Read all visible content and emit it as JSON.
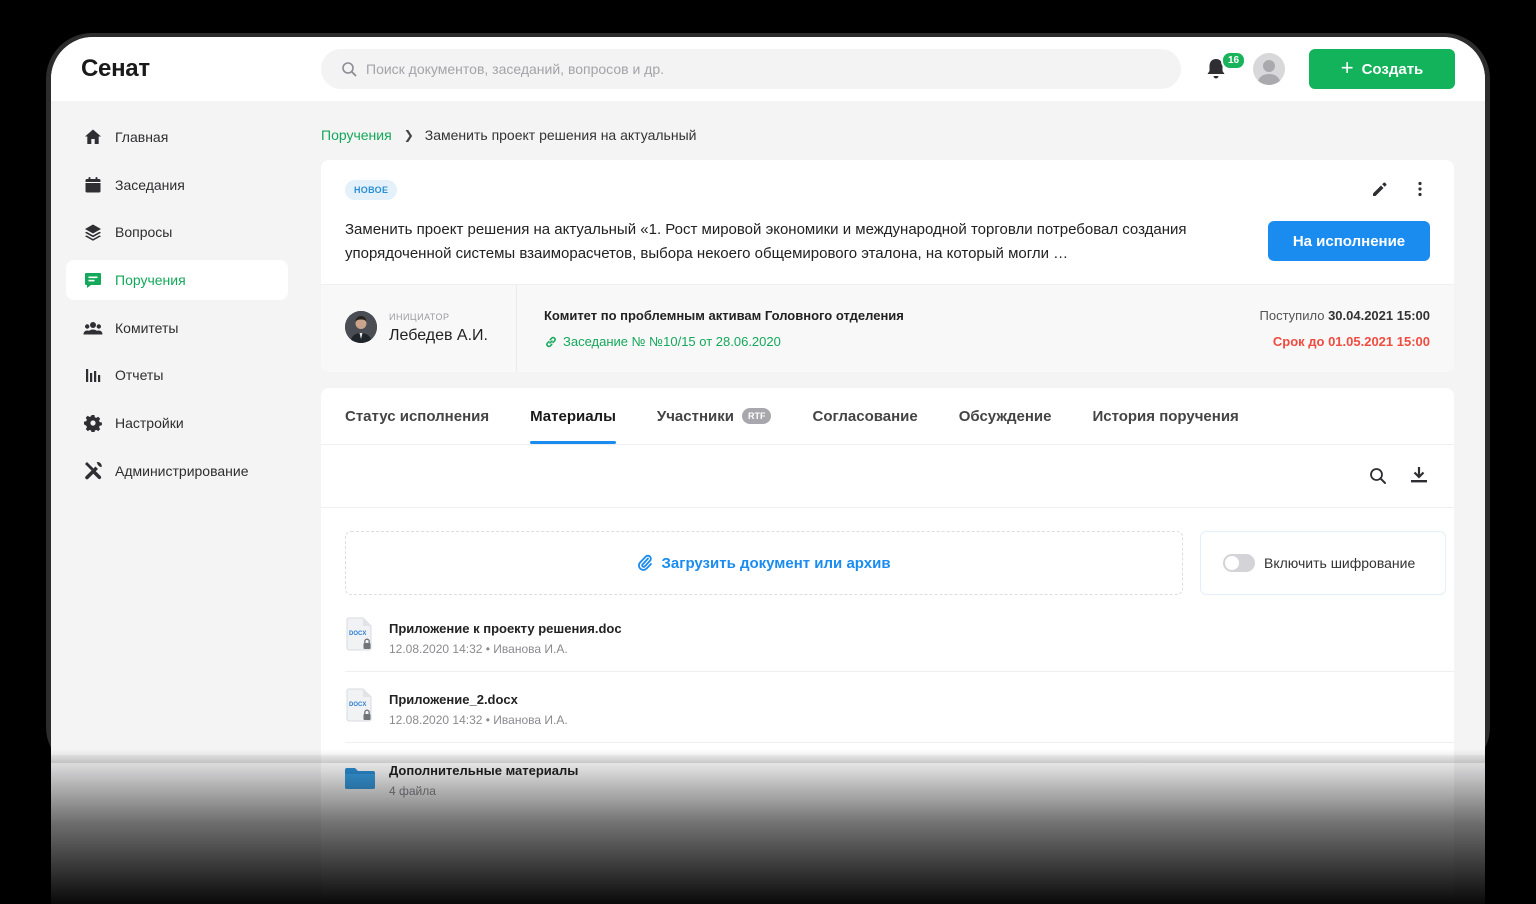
{
  "header": {
    "logo": "Сенат",
    "search_placeholder": "Поиск документов, заседаний, вопросов и др.",
    "notifications_count": "16",
    "create_label": "Создать"
  },
  "sidebar": {
    "items": [
      {
        "label": "Главная",
        "icon": "home-icon"
      },
      {
        "label": "Заседания",
        "icon": "calendar-icon"
      },
      {
        "label": "Вопросы",
        "icon": "layers-icon"
      },
      {
        "label": "Поручения",
        "icon": "message-icon",
        "active": true
      },
      {
        "label": "Комитеты",
        "icon": "people-icon"
      },
      {
        "label": "Отчеты",
        "icon": "bar-chart-icon"
      },
      {
        "label": "Настройки",
        "icon": "gear-icon"
      },
      {
        "label": "Администрирование",
        "icon": "tools-icon"
      }
    ]
  },
  "breadcrumb": {
    "parent": "Поручения",
    "current": "Заменить проект решения на актуальный"
  },
  "task": {
    "status": "НОВОЕ",
    "title": "Заменить проект решения на актуальный «1. Рост мировой экономики и международной торговли потребовал создания упорядоченной системы взаиморасчетов, выбора некоего общемирового эталона, на который могли …",
    "action_label": "На исполнение",
    "initiator_label": "ИНИЦИАТОР",
    "initiator_name": "Лебедев А.И.",
    "committee": "Комитет по проблемным активам Головного отделения",
    "meeting": "Заседание № №10/15 от 28.06.2020",
    "received_label": "Поступило",
    "received_date": "30.04.2021 15:00",
    "deadline": "Срок до 01.05.2021 15:00"
  },
  "tabs": [
    {
      "label": "Статус исполнения"
    },
    {
      "label": "Материалы",
      "active": true
    },
    {
      "label": "Участники",
      "badge": "RTF"
    },
    {
      "label": "Согласование"
    },
    {
      "label": "Обсуждение"
    },
    {
      "label": "История поручения"
    }
  ],
  "materials": {
    "upload_label": "Загрузить документ или архив",
    "encrypt_label": "Включить шифрование",
    "encrypt_enabled": false,
    "files": [
      {
        "name": "Приложение к проекту решения.doc",
        "meta": "12.08.2020 14:32 • Иванова И.А.",
        "type": "docx",
        "icon_label": "DOCX"
      },
      {
        "name": "Приложение_2.docx",
        "meta": "12.08.2020 14:32 • Иванова И.А.",
        "type": "docx",
        "icon_label": "DOCX"
      },
      {
        "name": "Дополнительные материалы",
        "meta": "4 файла",
        "type": "folder"
      }
    ]
  },
  "colors": {
    "accent_green": "#13b35b",
    "accent_blue": "#1a8cf0",
    "danger_red": "#ef4b3f"
  }
}
